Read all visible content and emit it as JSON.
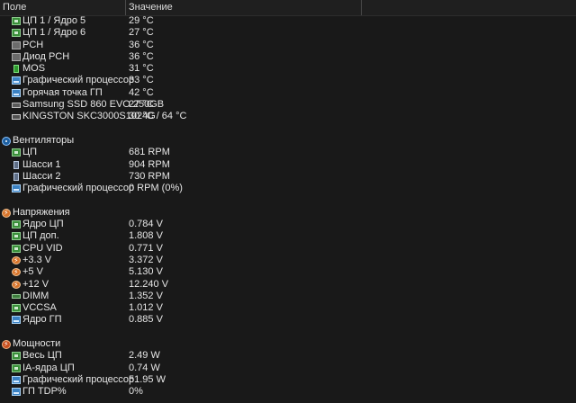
{
  "header": {
    "col_field": "Поле",
    "col_value": "Значение"
  },
  "rows": [
    {
      "kind": "item",
      "icon": "chip-icon",
      "cls": "chip",
      "name": "ЦП 1 / Ядро 5",
      "value": "29 °C"
    },
    {
      "kind": "item",
      "icon": "chip-icon",
      "cls": "chip",
      "name": "ЦП 1 / Ядро 6",
      "value": "27 °C"
    },
    {
      "kind": "item",
      "icon": "pch-chip-icon",
      "cls": "gray",
      "name": "PCH",
      "value": "36 °C"
    },
    {
      "kind": "item",
      "icon": "pch-chip-icon",
      "cls": "gray",
      "name": "Диод PCH",
      "value": "36 °C"
    },
    {
      "kind": "item",
      "icon": "mos-icon",
      "cls": "mos",
      "name": "MOS",
      "value": "31 °C"
    },
    {
      "kind": "item",
      "icon": "gpu-icon",
      "cls": "gpu",
      "name": "Графический процессор",
      "value": "33 °C"
    },
    {
      "kind": "item",
      "icon": "gpu-icon",
      "cls": "gpu",
      "name": "Горячая точка ГП",
      "value": "42 °C"
    },
    {
      "kind": "item",
      "icon": "disk-icon",
      "cls": "disk",
      "name": "Samsung SSD 860 EVO 250GB",
      "value": "27 °C"
    },
    {
      "kind": "item",
      "icon": "disk-icon",
      "cls": "disk2",
      "name": "KINGSTON SKC3000S1024G",
      "value": "30 °C / 64 °C"
    },
    {
      "kind": "blank"
    },
    {
      "kind": "group",
      "icon": "fan-icon",
      "cls": "fangroup",
      "name": "Вентиляторы",
      "value": ""
    },
    {
      "kind": "item",
      "icon": "chip-icon",
      "cls": "chip",
      "name": "ЦП",
      "value": "681 RPM"
    },
    {
      "kind": "item",
      "icon": "case-icon",
      "cls": "case",
      "name": "Шасси 1",
      "value": "904 RPM"
    },
    {
      "kind": "item",
      "icon": "case-icon",
      "cls": "case",
      "name": "Шасси 2",
      "value": "730 RPM"
    },
    {
      "kind": "item",
      "icon": "gpu-icon",
      "cls": "gpu",
      "name": "Графический процессор",
      "value": "0 RPM  (0%)"
    },
    {
      "kind": "blank"
    },
    {
      "kind": "group",
      "icon": "voltage-icon",
      "cls": "bolt",
      "name": "Напряжения",
      "value": ""
    },
    {
      "kind": "item",
      "icon": "chip-icon",
      "cls": "chip",
      "name": "Ядро ЦП",
      "value": "0.784 V"
    },
    {
      "kind": "item",
      "icon": "chip-icon",
      "cls": "chip",
      "name": "ЦП доп.",
      "value": "1.808 V"
    },
    {
      "kind": "item",
      "icon": "chip-icon",
      "cls": "chip",
      "name": "CPU VID",
      "value": "0.771 V"
    },
    {
      "kind": "item",
      "icon": "bolt-icon",
      "cls": "bolt",
      "name": "+3.3 V",
      "value": "3.372 V"
    },
    {
      "kind": "item",
      "icon": "bolt-icon",
      "cls": "bolt",
      "name": "+5 V",
      "value": "5.130 V"
    },
    {
      "kind": "item",
      "icon": "bolt-icon",
      "cls": "bolt",
      "name": "+12 V",
      "value": "12.240 V"
    },
    {
      "kind": "item",
      "icon": "dimm-icon",
      "cls": "dimm",
      "name": "DIMM",
      "value": "1.352 V"
    },
    {
      "kind": "item",
      "icon": "chip-icon",
      "cls": "chip",
      "name": "VCCSA",
      "value": "1.012 V"
    },
    {
      "kind": "item",
      "icon": "gpu-icon",
      "cls": "gpu",
      "name": "Ядро ГП",
      "value": "0.885 V"
    },
    {
      "kind": "blank"
    },
    {
      "kind": "group",
      "icon": "power-icon",
      "cls": "power",
      "name": "Мощности",
      "value": ""
    },
    {
      "kind": "item",
      "icon": "chip-icon",
      "cls": "chip",
      "name": "Весь ЦП",
      "value": "2.49 W"
    },
    {
      "kind": "item",
      "icon": "chip-icon",
      "cls": "chip",
      "name": "IA-ядра ЦП",
      "value": "0.74 W"
    },
    {
      "kind": "item",
      "icon": "gpu-icon",
      "cls": "gpu",
      "name": "Графический процессор",
      "value": "51.95 W"
    },
    {
      "kind": "item",
      "icon": "gpu-icon",
      "cls": "gpu",
      "name": "ГП TDP%",
      "value": "0%"
    }
  ]
}
